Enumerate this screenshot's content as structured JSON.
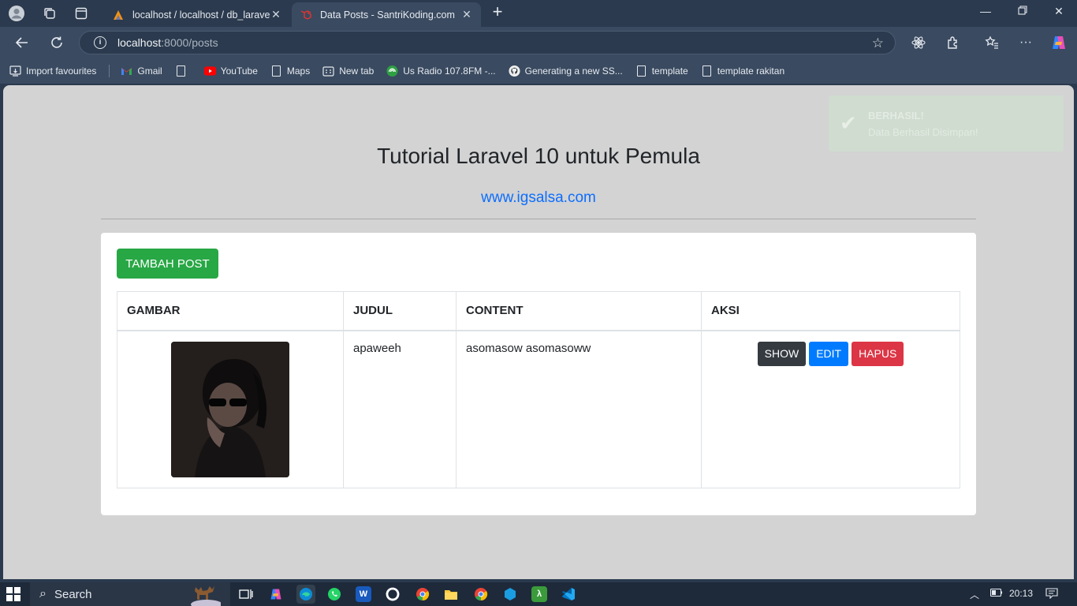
{
  "browser": {
    "tabs": [
      {
        "title": "localhost / localhost / db_laravel_",
        "active": false
      },
      {
        "title": "Data Posts - SantriKoding.com",
        "active": true
      }
    ],
    "url_host": "localhost",
    "url_path": ":8000/posts",
    "bookmarks": [
      {
        "label": "Import favourites",
        "icon": "import-icon"
      },
      {
        "label": "Gmail",
        "icon": "gmail-icon"
      },
      {
        "label": "",
        "icon": "page-icon"
      },
      {
        "label": "YouTube",
        "icon": "youtube-icon"
      },
      {
        "label": "Maps",
        "icon": "page-icon"
      },
      {
        "label": "New tab",
        "icon": "newtab-icon"
      },
      {
        "label": "Us Radio 107.8FM -...",
        "icon": "radio-icon"
      },
      {
        "label": "Generating a new SS...",
        "icon": "github-icon"
      },
      {
        "label": "template",
        "icon": "page-icon"
      },
      {
        "label": "template rakitan",
        "icon": "page-icon"
      }
    ]
  },
  "page": {
    "title": "Tutorial Laravel 10 untuk Pemula",
    "link": "www.igsalsa.com",
    "add_button": "TAMBAH POST",
    "table": {
      "headers": [
        "GAMBAR",
        "JUDUL",
        "CONTENT",
        "AKSI"
      ],
      "rows": [
        {
          "judul": "apaweeh",
          "content": "asomasow asomasoww"
        }
      ],
      "actions": {
        "show": "SHOW",
        "edit": "EDIT",
        "delete": "HAPUS"
      }
    },
    "toast": {
      "title": "BERHASIL!",
      "message": "Data Berhasil Disimpan!"
    }
  },
  "taskbar": {
    "search_label": "Search",
    "time": "20:13"
  },
  "colors": {
    "success": "#28a745",
    "primary": "#007bff",
    "danger": "#dc3545",
    "dark": "#343a40",
    "link": "#0d6efd"
  }
}
